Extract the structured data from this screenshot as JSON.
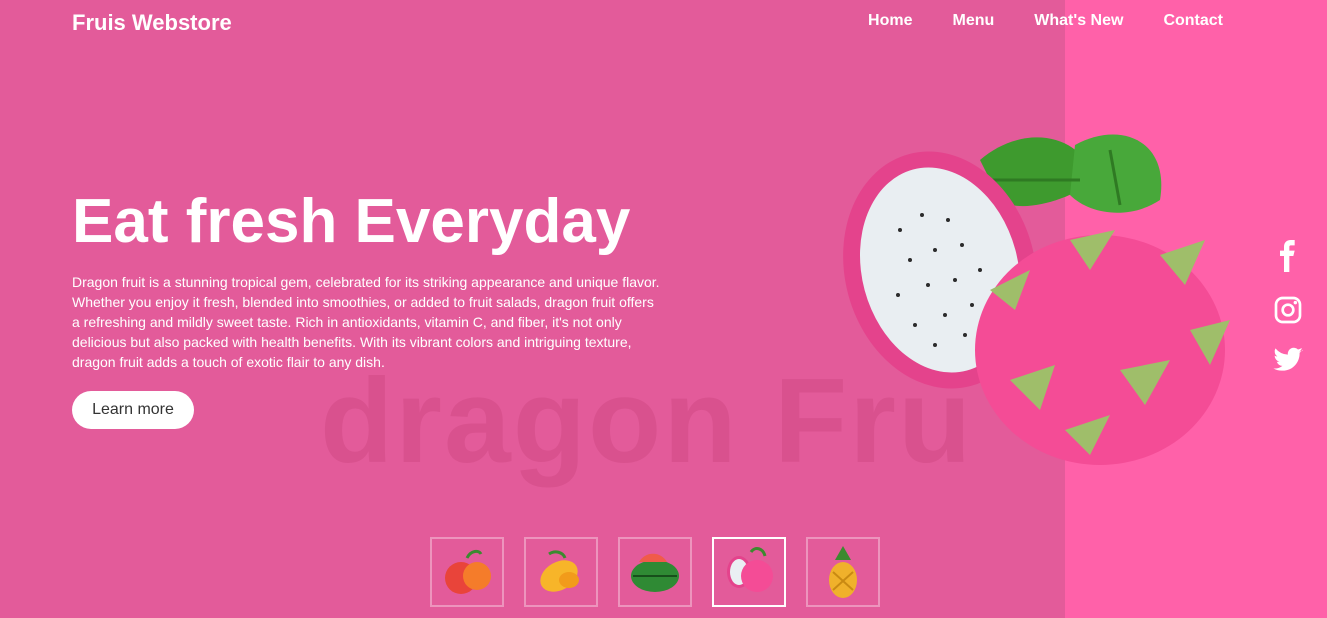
{
  "brand": "Fruis Webstore",
  "nav": [
    "Home",
    "Menu",
    "What's New",
    "Contact"
  ],
  "hero": {
    "watermark": "dragon Fru",
    "headline": "Eat fresh Everyday",
    "description": "Dragon fruit is a stunning tropical gem, celebrated for its striking appearance and unique flavor. Whether you enjoy it fresh, blended into smoothies, or added to fruit salads, dragon fruit offers a refreshing and mildly sweet taste. Rich in antioxidants, vitamin C, and fiber, it's not only delicious but also packed with health benefits. With its vibrant colors and intriguing texture, dragon fruit adds a touch of exotic flair to any dish.",
    "button": "Learn more"
  },
  "social": [
    "facebook-icon",
    "instagram-icon",
    "twitter-icon"
  ],
  "thumbnails": [
    {
      "name": "apple",
      "active": false
    },
    {
      "name": "mango",
      "active": false
    },
    {
      "name": "watermelon",
      "active": false
    },
    {
      "name": "dragon-fruit",
      "active": true
    },
    {
      "name": "pineapple",
      "active": false
    }
  ],
  "colors": {
    "background": "#e35b9a",
    "accent_panel": "#ff61a9",
    "text": "#ffffff"
  }
}
